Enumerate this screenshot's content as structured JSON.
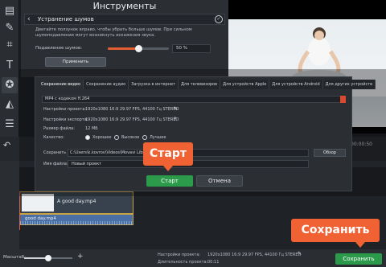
{
  "tools_panel": {
    "title": "Инструменты",
    "back_icon": "chevron-left",
    "header_label": "Устранение шумов",
    "description": "Двигайте ползунок вправо, чтобы убрать больше шумов. При сильном шумоподавлении могут возникнуть искажения звука.",
    "slider_label": "Подавление шумов:",
    "slider_value": "50 %",
    "slider_fraction": 0.5,
    "apply_label": "Применить"
  },
  "left_tools": [
    "film-icon",
    "magic-wand-icon",
    "crop-icon",
    "text-icon",
    "star-icon",
    "shapes-icon",
    "list-icon"
  ],
  "save_dialog": {
    "tabs": [
      "Сохранение видео",
      "Сохранение аудио",
      "Загрузка в интернет",
      "Для телевизоров",
      "Для устройств Apple",
      "Для устройств Android",
      "Для других устройств"
    ],
    "active_tab": 0,
    "format": "MP4 с кодеком H.264",
    "project_settings_label": "Настройки проекта:",
    "project_settings_value": "1920x1080 16:9 29.97 FPS, 44100 Гц STEREO",
    "export_settings_label": "Настройки экспорта:",
    "export_settings_value": "1920x1080 16:9 29.97 FPS, 44100 Гц STEREO",
    "file_size_label": "Размер файла:",
    "file_size_value": "12 МБ",
    "quality_label": "Качество:",
    "quality_options": [
      "Хорошее",
      "Высокое",
      "Лучшее"
    ],
    "quality_selected": 0,
    "save_to_label": "Сохранить в:",
    "save_to_value": "C:\\Users\\k.kovrov\\Videos\\Movavi Libr",
    "browse_label": "Обзор",
    "filename_label": "Имя файла:",
    "filename_value": "Новый проект",
    "start_label": "Старт",
    "cancel_label": "Отмена"
  },
  "timeline": {
    "video_clip": "A good day.mp4",
    "audio_clip": "good day.mp4",
    "time_readout": "00:00:50"
  },
  "bottom_bar": {
    "zoom_label": "Масштаб:",
    "zoom_fraction": 0.5,
    "project_settings_label": "Настройки проекта:",
    "project_settings_value": "1920x1080 16:9 29.97 FPS, 44100 Гц STEREO",
    "duration_label": "Длительность проекта:",
    "duration_value": "00:11",
    "save_label": "Сохранить"
  },
  "callouts": {
    "start": "Старт",
    "save": "Сохранить"
  },
  "colors": {
    "accent_orange": "#f06233",
    "save_green": "#2b9a4a",
    "slider_fill": "#e35d32",
    "clip_border": "#c9a24a",
    "audio_clip": "#4a6fa5"
  }
}
